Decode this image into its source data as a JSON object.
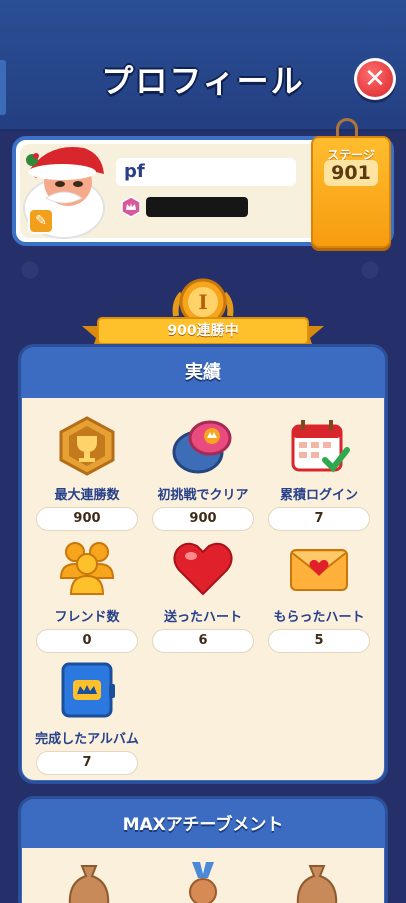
{
  "header": {
    "title": "プロフィール"
  },
  "profile": {
    "name": "pf",
    "stage_label": "ステージ",
    "stage_value": "901"
  },
  "streak": {
    "medal_numeral": "I",
    "ribbon_text": "900連勝中"
  },
  "achievements": {
    "title": "実績",
    "stats": [
      {
        "label": "最大連勝数",
        "value": "900",
        "icon": "trophy-badge-icon"
      },
      {
        "label": "初挑戦でクリア",
        "value": "900",
        "icon": "first-try-button-icon"
      },
      {
        "label": "累積ログイン",
        "value": "7",
        "icon": "calendar-check-icon"
      },
      {
        "label": "フレンド数",
        "value": "0",
        "icon": "friends-icon"
      },
      {
        "label": "送ったハート",
        "value": "6",
        "icon": "heart-icon"
      },
      {
        "label": "もらったハート",
        "value": "5",
        "icon": "heart-envelope-icon"
      },
      {
        "label": "完成したアルバム",
        "value": "7",
        "icon": "album-icon"
      }
    ]
  },
  "max_achievements": {
    "title": "MAXアチーブメント"
  },
  "colors": {
    "accent_blue": "#3b6cc2",
    "gold": "#f7a51c",
    "close_red": "#d8262c",
    "background": "#25306a"
  }
}
